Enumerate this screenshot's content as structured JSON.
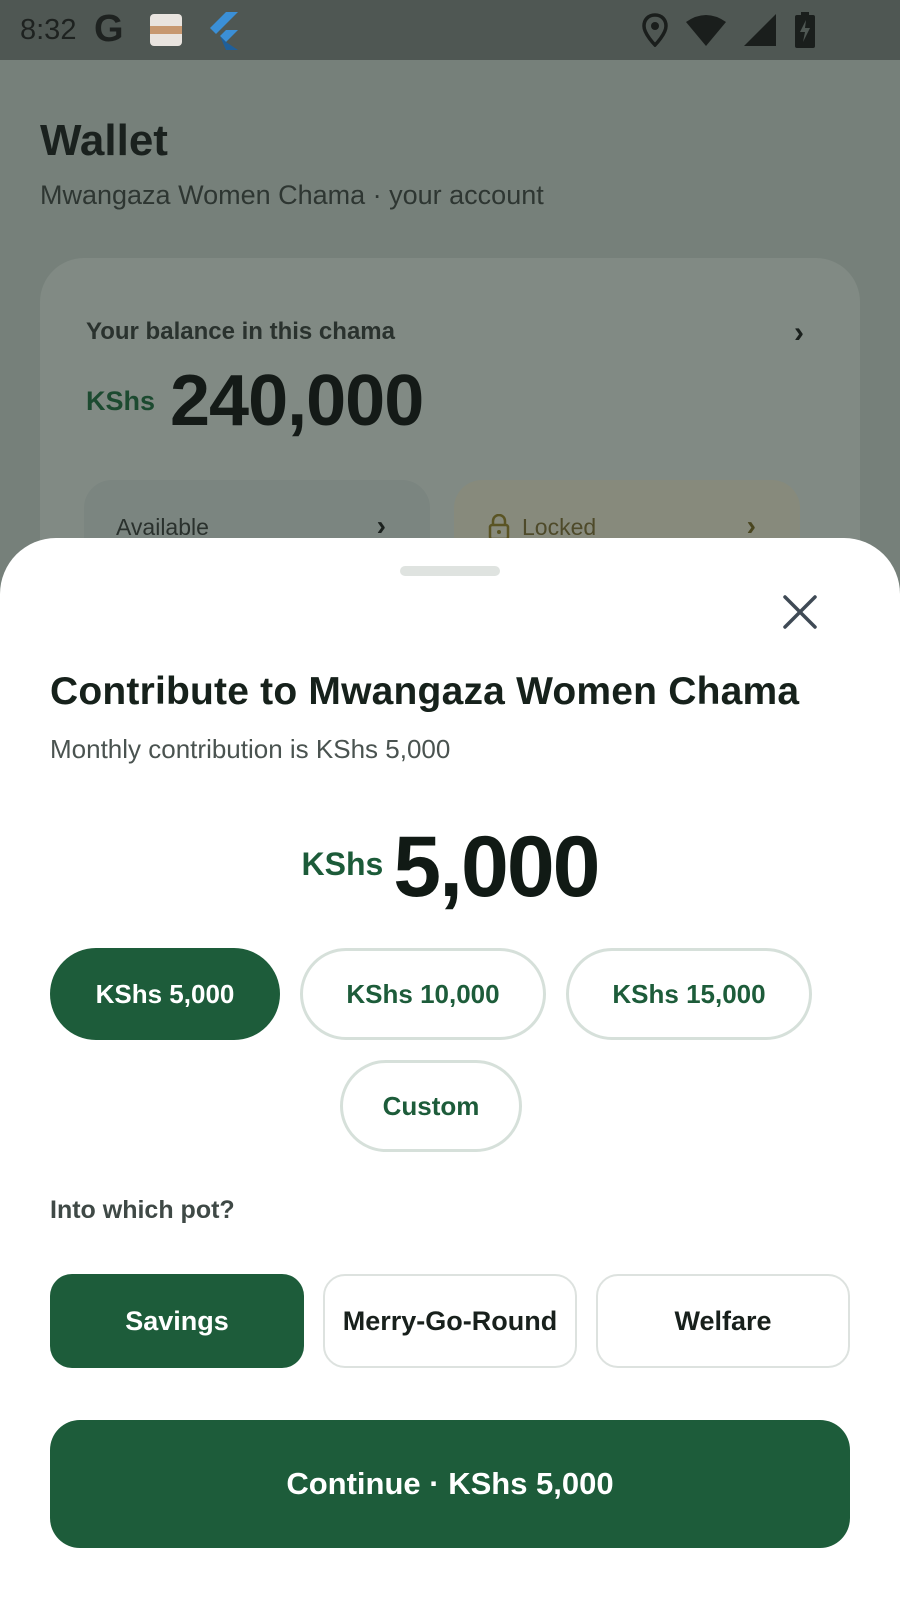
{
  "status_bar": {
    "time": "8:32",
    "g_logo": "G"
  },
  "wallet": {
    "title": "Wallet",
    "subtitle": "Mwangaza Women Chama · your account",
    "balance_label": "Your balance in this chama",
    "currency": "KShs",
    "balance": "240,000",
    "available_label": "Available",
    "locked_label": "Locked"
  },
  "sheet": {
    "title": "Contribute to Mwangaza Women Chama",
    "subtitle": "Monthly contribution is KShs 5,000",
    "amount_currency": "KShs",
    "amount_value": "5,000",
    "amount_chips": [
      {
        "label": "KShs 5,000",
        "selected": true
      },
      {
        "label": "KShs 10,000",
        "selected": false
      },
      {
        "label": "KShs 15,000",
        "selected": false
      },
      {
        "label": "Custom",
        "selected": false
      }
    ],
    "pot_label": "Into which pot?",
    "pots": [
      {
        "label": "Savings",
        "selected": true
      },
      {
        "label": "Merry-Go-Round",
        "selected": false
      },
      {
        "label": "Welfare",
        "selected": false
      }
    ],
    "continue_label": "Continue · KShs 5,000"
  },
  "colors": {
    "brand_green": "#1d5c3a",
    "scrim": "#76807a",
    "sheet_bg": "#ffffff"
  },
  "icons": {
    "close": "close-icon",
    "chevron": "chevron-right-icon",
    "lock": "lock-icon",
    "location": "location-icon",
    "wifi": "wifi-icon",
    "signal": "signal-icon",
    "battery": "battery-charging-icon"
  }
}
